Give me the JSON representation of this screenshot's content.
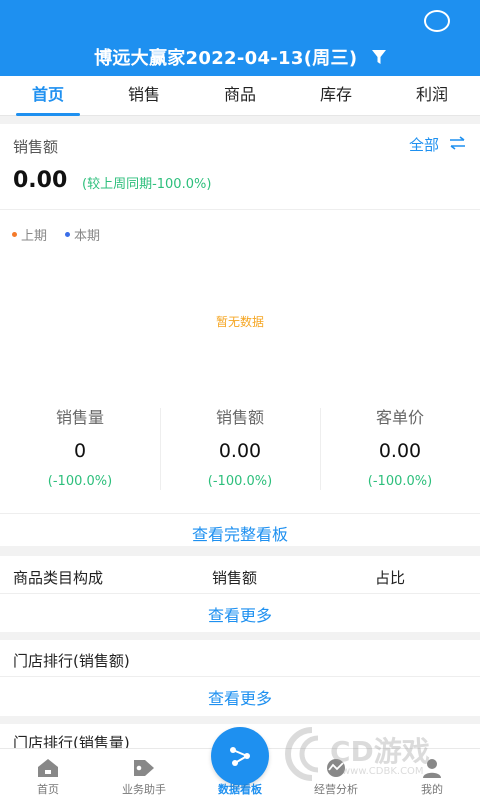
{
  "header": {
    "title": "博远大赢家2022-04-13(周三)",
    "bg_color": "#1e90f0"
  },
  "tabs": [
    {
      "label": "首页",
      "active": true
    },
    {
      "label": "销售",
      "active": false
    },
    {
      "label": "商品",
      "active": false
    },
    {
      "label": "库存",
      "active": false
    },
    {
      "label": "利润",
      "active": false
    }
  ],
  "overview": {
    "sales_label": "销售额",
    "all_label": "全部",
    "value": "0.00",
    "compare": "(较上周同期-100.0%)",
    "legend_prev": "上期",
    "legend_curr": "本期",
    "legend_prev_color": "#f47a2a",
    "legend_curr_color": "#3a6ee8",
    "no_data": "暂无数据"
  },
  "stats": [
    {
      "label": "销售量",
      "value": "0",
      "change": "(-100.0%)"
    },
    {
      "label": "销售额",
      "value": "0.00",
      "change": "(-100.0%)"
    },
    {
      "label": "客单价",
      "value": "0.00",
      "change": "(-100.0%)"
    }
  ],
  "full_board_label": "查看完整看板",
  "category": {
    "col1": "商品类目构成",
    "col2": "销售额",
    "col3": "占比",
    "more": "查看更多"
  },
  "store_rank_amount": {
    "title": "门店排行(销售额)",
    "more": "查看更多"
  },
  "store_rank_qty": {
    "title": "门店排行(销售量)"
  },
  "tabbar": [
    {
      "label": "首页",
      "icon": "home-icon"
    },
    {
      "label": "业务助手",
      "icon": "tag-icon"
    },
    {
      "label": "数据看板",
      "icon": "share-network-icon",
      "active": true
    },
    {
      "label": "经营分析",
      "icon": "chart-icon"
    },
    {
      "label": "我的",
      "icon": "user-icon"
    }
  ],
  "watermark": {
    "text": "CD游戏",
    "url": "www.CDBK.COM"
  }
}
